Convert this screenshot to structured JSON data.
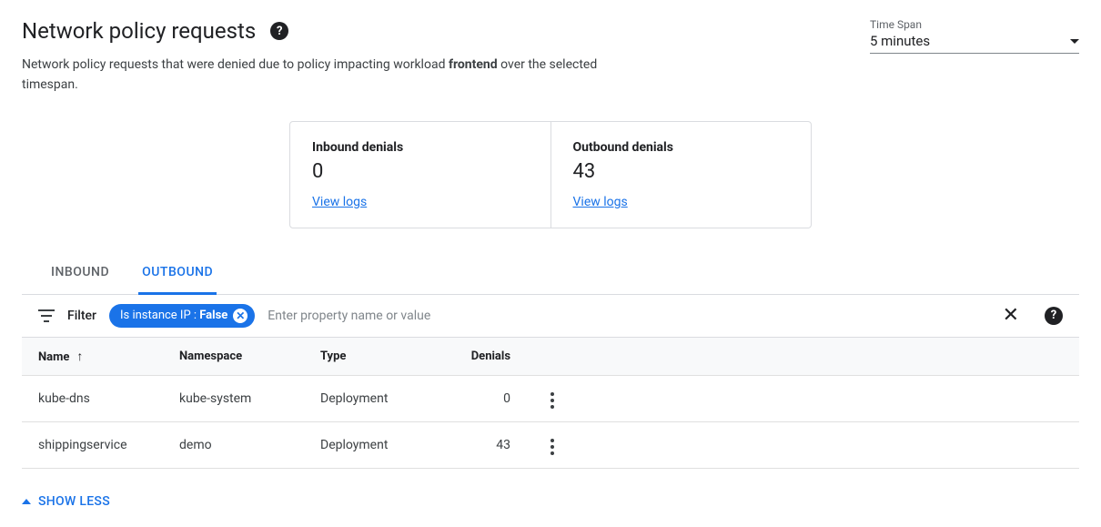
{
  "header": {
    "title": "Network policy requests",
    "subtitle_prefix": "Network policy requests that were denied due to policy impacting workload ",
    "subtitle_bold": "frontend",
    "subtitle_suffix": " over the selected timespan."
  },
  "timespan": {
    "label": "Time Span",
    "value": "5 minutes"
  },
  "stats": {
    "inbound": {
      "label": "Inbound denials",
      "value": "0",
      "link": "View logs"
    },
    "outbound": {
      "label": "Outbound denials",
      "value": "43",
      "link": "View logs"
    }
  },
  "tabs": {
    "inbound": "INBOUND",
    "outbound": "OUTBOUND"
  },
  "filter": {
    "label": "Filter",
    "chip_key": "Is instance IP : ",
    "chip_val": "False",
    "placeholder": "Enter property name or value"
  },
  "table": {
    "headers": {
      "name": "Name",
      "namespace": "Namespace",
      "type": "Type",
      "denials": "Denials"
    },
    "rows": [
      {
        "name": "kube-dns",
        "namespace": "kube-system",
        "type": "Deployment",
        "denials": "0"
      },
      {
        "name": "shippingservice",
        "namespace": "demo",
        "type": "Deployment",
        "denials": "43"
      }
    ]
  },
  "footer": {
    "show_less": "SHOW LESS"
  }
}
